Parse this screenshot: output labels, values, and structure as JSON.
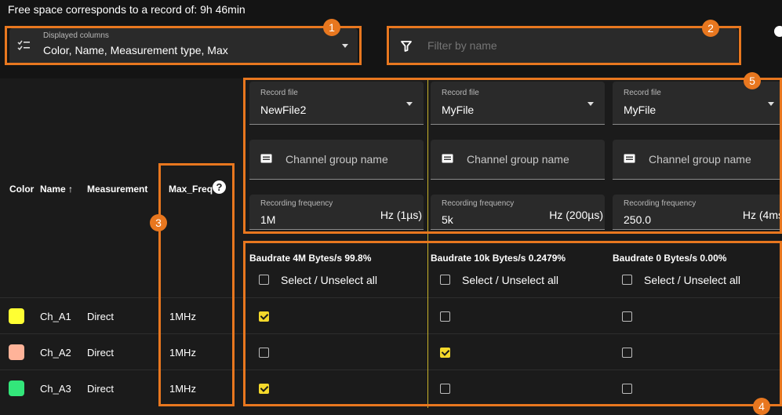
{
  "header": {
    "free_space_text": "Free space corresponds to a record of: 9h 46min",
    "displayed_columns": {
      "label": "Displayed columns",
      "value": "Color, Name, Measurement type, Max"
    },
    "filter": {
      "placeholder": "Filter by name"
    }
  },
  "badges": [
    "1",
    "2",
    "3",
    "4",
    "5"
  ],
  "table": {
    "headers": {
      "color": "Color",
      "name": "Name ↑",
      "measurement": "Measurement",
      "max_freq": "Max_Freq"
    },
    "rows": [
      {
        "color": "#ffff33",
        "name": "Ch_A1",
        "measurement": "Direct",
        "max_freq": "1MHz"
      },
      {
        "color": "#ffb399",
        "name": "Ch_A2",
        "measurement": "Direct",
        "max_freq": "1MHz"
      },
      {
        "color": "#33e67a",
        "name": "Ch_A3",
        "measurement": "Direct",
        "max_freq": "1MHz"
      }
    ]
  },
  "record_columns": [
    {
      "record_file_label": "Record file",
      "record_file_value": "NewFile2",
      "group_placeholder": "Channel group name",
      "freq_label": "Recording frequency",
      "freq_value": "1M",
      "freq_unit": "Hz (1µs)",
      "baudrate": "Baudrate 4M Bytes/s 99.8%",
      "select_all": "Select / Unselect all",
      "checks": [
        true,
        false,
        true
      ]
    },
    {
      "record_file_label": "Record file",
      "record_file_value": "MyFile",
      "group_placeholder": "Channel group name",
      "freq_label": "Recording frequency",
      "freq_value": "5k",
      "freq_unit": "Hz (200µs)",
      "baudrate": "Baudrate 10k Bytes/s 0.2479%",
      "select_all": "Select / Unselect all",
      "checks": [
        false,
        true,
        false
      ]
    },
    {
      "record_file_label": "Record file",
      "record_file_value": "MyFile",
      "group_placeholder": "Channel group name",
      "freq_label": "Recording frequency",
      "freq_value": "250.0",
      "freq_unit": "Hz (4ms",
      "baudrate": "Baudrate 0 Bytes/s 0.00%",
      "select_all": "Select / Unselect all",
      "checks": [
        false,
        false,
        false
      ]
    }
  ]
}
